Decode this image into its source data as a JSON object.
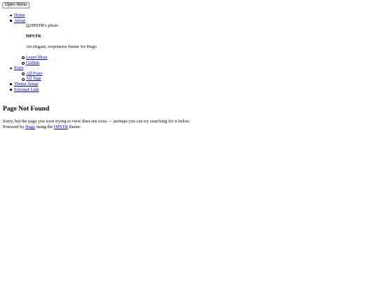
{
  "header": {
    "menu_button_label": "Open Menu"
  },
  "nav": {
    "home": "Home",
    "about": "About",
    "about_card": {
      "photo_alt": "HPSTR's photo",
      "name": "HPSTR",
      "description": "An elegant, responsive theme for Hugo",
      "links": [
        "Learn More",
        "GitHub"
      ]
    },
    "posts": "Posts",
    "posts_sub": [
      "All Posts",
      "All Tags"
    ],
    "theme_setup": "Theme Setup",
    "external_link": "External Link"
  },
  "main": {
    "title": "Page Not Found",
    "message": "Sorry, but the page you were trying to view does not exist — perhaps you can try searching for it below."
  },
  "footer": {
    "prefix": "Powered by ",
    "hugo_link": "Hugo",
    "middle": " using the ",
    "theme_link": "HPSTR",
    "suffix": " theme."
  },
  "colors": {
    "link": "#0000ee",
    "text": "#000000",
    "background": "#ffffff"
  },
  "icons": {
    "broken_image": "broken-image-icon"
  }
}
